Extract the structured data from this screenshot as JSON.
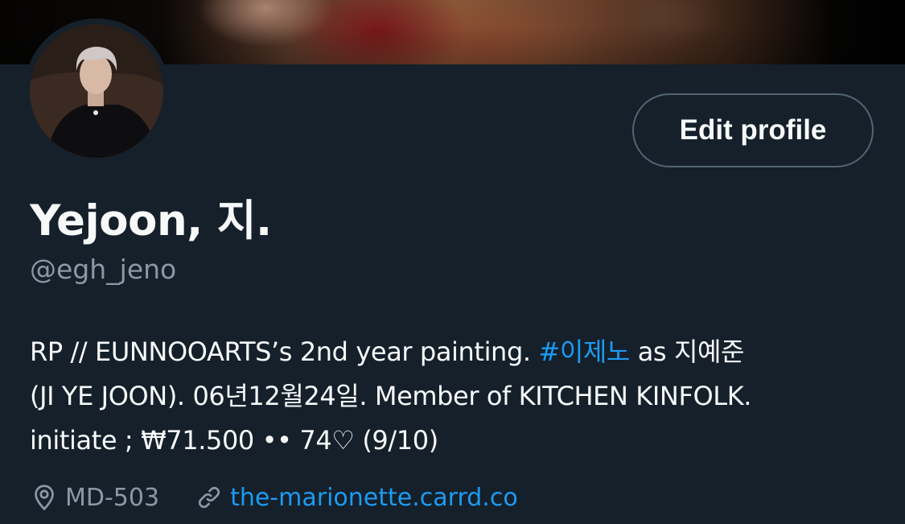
{
  "profile": {
    "display_name": "Yejoon, 지.",
    "handle": "@egh_jeno",
    "edit_button_label": "Edit profile",
    "bio": {
      "line1_prefix": "RP // EUNNOOARTS’s 2nd year painting. ",
      "hashtag": "#이제노",
      "line1_suffix": " as 지예준",
      "line2": "(JI YE JOON). 06년12월24일. Member of KITCHEN KINFOLK.",
      "line3": "initiate ; ₩71.500 •• 74♡ (9/10)"
    },
    "location": "MD-503",
    "website": "the-marionette.carrd.co"
  },
  "icons": {
    "location": "location-pin-icon",
    "link": "link-icon"
  },
  "colors": {
    "background": "#15202b",
    "primary_text": "#f7f9f9",
    "secondary_text": "#8b98a5",
    "accent": "#1d9bf0",
    "button_border": "#536471"
  }
}
